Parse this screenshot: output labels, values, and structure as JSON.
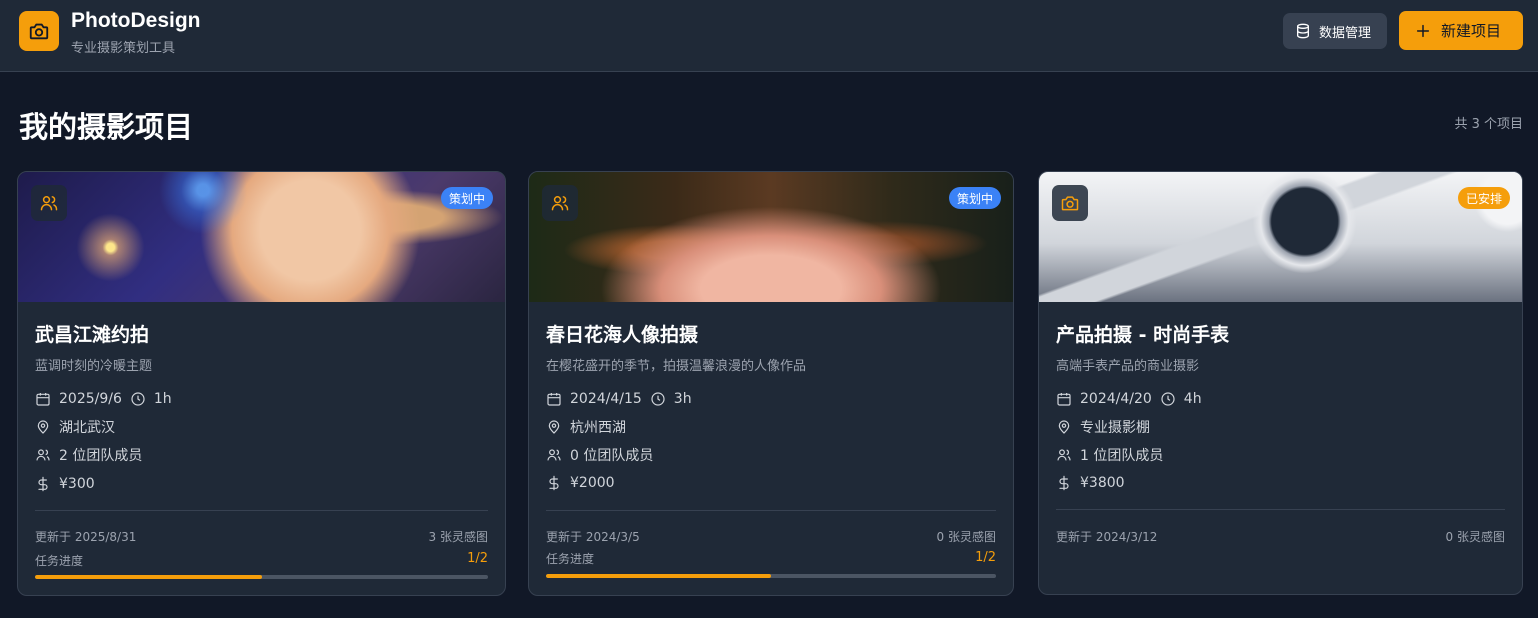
{
  "header": {
    "brand_title": "PhotoDesign",
    "brand_subtitle": "专业摄影策划工具",
    "data_button": "数据管理",
    "new_button": "新建项目",
    "brand_color": "#f59e0b"
  },
  "main": {
    "title": "我的摄影项目",
    "count_text": "共 3 个项目"
  },
  "projects": [
    {
      "type_icon": "users-icon",
      "status": "策划中",
      "status_color": "#3b82f6",
      "title": "武昌江滩约拍",
      "description": "蓝调时刻的冷暖主题",
      "date": "2025/9/6",
      "duration": "1h",
      "location": "湖北武汉",
      "team": "2 位团队成员",
      "budget": "¥300",
      "updated": "更新于 2025/8/31",
      "inspiration": "3 张灵感图",
      "task_label": "任务进度",
      "task_value": "1/2",
      "task_progress": 0.5
    },
    {
      "type_icon": "users-icon",
      "status": "策划中",
      "status_color": "#3b82f6",
      "title": "春日花海人像拍摄",
      "description": "在樱花盛开的季节，拍摄温馨浪漫的人像作品",
      "date": "2024/4/15",
      "duration": "3h",
      "location": "杭州西湖",
      "team": "0 位团队成员",
      "budget": "¥2000",
      "updated": "更新于 2024/3/5",
      "inspiration": "0 张灵感图",
      "task_label": "任务进度",
      "task_value": "1/2",
      "task_progress": 0.5
    },
    {
      "type_icon": "camera-icon",
      "status": "已安排",
      "status_color": "#f59e0b",
      "title": "产品拍摄 - 时尚手表",
      "description": "高端手表产品的商业摄影",
      "date": "2024/4/20",
      "duration": "4h",
      "location": "专业摄影棚",
      "team": "1 位团队成员",
      "budget": "¥3800",
      "updated": "更新于 2024/3/12",
      "inspiration": "0 张灵感图"
    }
  ]
}
